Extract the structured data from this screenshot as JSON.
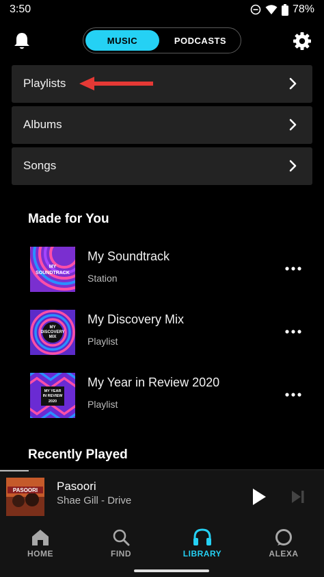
{
  "status": {
    "time": "3:50",
    "battery": "78%"
  },
  "header": {
    "tabs": [
      "MUSIC",
      "PODCASTS"
    ],
    "active_tab": "MUSIC"
  },
  "library_rows": [
    {
      "label": "Playlists"
    },
    {
      "label": "Albums"
    },
    {
      "label": "Songs"
    }
  ],
  "made_for_you": {
    "title": "Made for You",
    "items": [
      {
        "title": "My Soundtrack",
        "subtitle": "Station",
        "art_text": "MY SOUNDTRACK"
      },
      {
        "title": "My Discovery Mix",
        "subtitle": "Playlist",
        "art_text": "MY DISCOVERY MIX"
      },
      {
        "title": "My Year in Review 2020",
        "subtitle": "Playlist",
        "art_text": "MY YEAR IN REVIEW 2020"
      }
    ]
  },
  "recently_played": {
    "title": "Recently Played"
  },
  "now_playing": {
    "title": "Pasoori",
    "artist": "Shae Gill - Drive",
    "art_text": "PASOORI"
  },
  "bottom_nav": [
    {
      "label": "HOME",
      "icon": "home-icon"
    },
    {
      "label": "FIND",
      "icon": "search-icon"
    },
    {
      "label": "LIBRARY",
      "icon": "headphones-icon",
      "active": true
    },
    {
      "label": "ALEXA",
      "icon": "alexa-icon"
    }
  ],
  "colors": {
    "accent": "#25d1f4",
    "row_bg": "#232323",
    "annotation_arrow": "#e53935"
  }
}
